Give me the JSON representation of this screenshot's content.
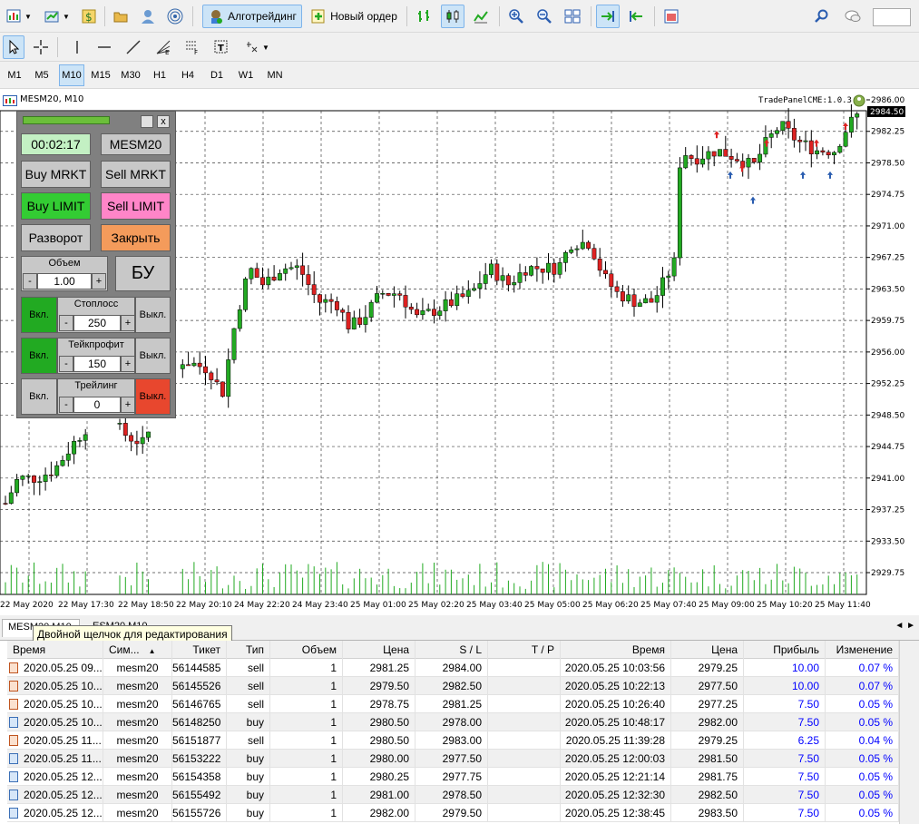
{
  "toolbar": {
    "algo_label": "Алготрейдинг",
    "new_order_label": "Новый ордер"
  },
  "timeframes": [
    "M1",
    "M5",
    "M10",
    "M15",
    "M30",
    "H1",
    "H4",
    "D1",
    "W1",
    "MN"
  ],
  "active_timeframe": "M10",
  "chart": {
    "title": "MESM20, M10",
    "panel_label": "TradePanelCME:1.0.3",
    "current_price": "2984.50",
    "price_axis": [
      "2986.00",
      "2982.25",
      "2978.50",
      "2974.75",
      "2971.00",
      "2967.25",
      "2963.50",
      "2959.75",
      "2956.00",
      "2952.25",
      "2948.50",
      "2944.75",
      "2941.00",
      "2937.25",
      "2933.50",
      "2929.75"
    ],
    "time_axis": [
      "22 May 2020",
      "22 May 17:30",
      "22 May 18:50",
      "22 May 20:10",
      "24 May 22:20",
      "24 May 23:40",
      "25 May 01:00",
      "25 May 02:20",
      "25 May 03:40",
      "25 May 05:00",
      "25 May 06:20",
      "25 May 07:40",
      "25 May 09:00",
      "25 May 10:20",
      "25 May 11:40"
    ],
    "colors": {
      "bull": "#22aa22",
      "bear": "#dd2222",
      "grid": "#404040"
    }
  },
  "panel": {
    "timer": "00:02:17",
    "symbol": "MESM20",
    "buy_mrkt": "Buy MRKT",
    "sell_mrkt": "Sell MRKT",
    "buy_limit": "Buy LIMIT",
    "sell_limit": "Sell LIMIT",
    "reverse": "Разворот",
    "close": "Закрыть",
    "volume_label": "Объем",
    "volume_value": "1.00",
    "minus": "-",
    "plus": "+",
    "bu": "БУ",
    "on": "Вкл.",
    "off": "Выкл.",
    "stoploss_label": "Стоплосс",
    "stoploss_value": "250",
    "takeprofit_label": "Тейкпрофит",
    "takeprofit_value": "150",
    "trailing_label": "Трейлинг",
    "trailing_value": "0",
    "close_x": "x"
  },
  "tabs": [
    "MESM20,M10",
    "ESM20,M10"
  ],
  "tooltip": "Двойной щелчок для редактирования",
  "table": {
    "headers": [
      "Время",
      "Сим...",
      "Тикет",
      "Тип",
      "Объем",
      "Цена",
      "S / L",
      "T / P",
      "Время",
      "Цена",
      "Прибыль",
      "Изменение"
    ],
    "rows": [
      [
        "2020.05.25 09...",
        "mesm20",
        "56144585",
        "sell",
        "1",
        "2981.25",
        "2984.00",
        "",
        "2020.05.25 10:03:56",
        "2979.25",
        "10.00",
        "0.07 %"
      ],
      [
        "2020.05.25 10...",
        "mesm20",
        "56145526",
        "sell",
        "1",
        "2979.50",
        "2982.50",
        "",
        "2020.05.25 10:22:13",
        "2977.50",
        "10.00",
        "0.07 %"
      ],
      [
        "2020.05.25 10...",
        "mesm20",
        "56146765",
        "sell",
        "1",
        "2978.75",
        "2981.25",
        "",
        "2020.05.25 10:26:40",
        "2977.25",
        "7.50",
        "0.05 %"
      ],
      [
        "2020.05.25 10...",
        "mesm20",
        "56148250",
        "buy",
        "1",
        "2980.50",
        "2978.00",
        "",
        "2020.05.25 10:48:17",
        "2982.00",
        "7.50",
        "0.05 %"
      ],
      [
        "2020.05.25 11...",
        "mesm20",
        "56151877",
        "sell",
        "1",
        "2980.50",
        "2983.00",
        "",
        "2020.05.25 11:39:28",
        "2979.25",
        "6.25",
        "0.04 %"
      ],
      [
        "2020.05.25 11...",
        "mesm20",
        "56153222",
        "buy",
        "1",
        "2980.00",
        "2977.50",
        "",
        "2020.05.25 12:00:03",
        "2981.50",
        "7.50",
        "0.05 %"
      ],
      [
        "2020.05.25 12...",
        "mesm20",
        "56154358",
        "buy",
        "1",
        "2980.25",
        "2977.75",
        "",
        "2020.05.25 12:21:14",
        "2981.75",
        "7.50",
        "0.05 %"
      ],
      [
        "2020.05.25 12...",
        "mesm20",
        "56155492",
        "buy",
        "1",
        "2981.00",
        "2978.50",
        "",
        "2020.05.25 12:32:30",
        "2982.50",
        "7.50",
        "0.05 %"
      ],
      [
        "2020.05.25 12...",
        "mesm20",
        "56155726",
        "buy",
        "1",
        "2982.00",
        "2979.50",
        "",
        "2020.05.25 12:38:45",
        "2983.50",
        "7.50",
        "0.05 %"
      ]
    ]
  }
}
